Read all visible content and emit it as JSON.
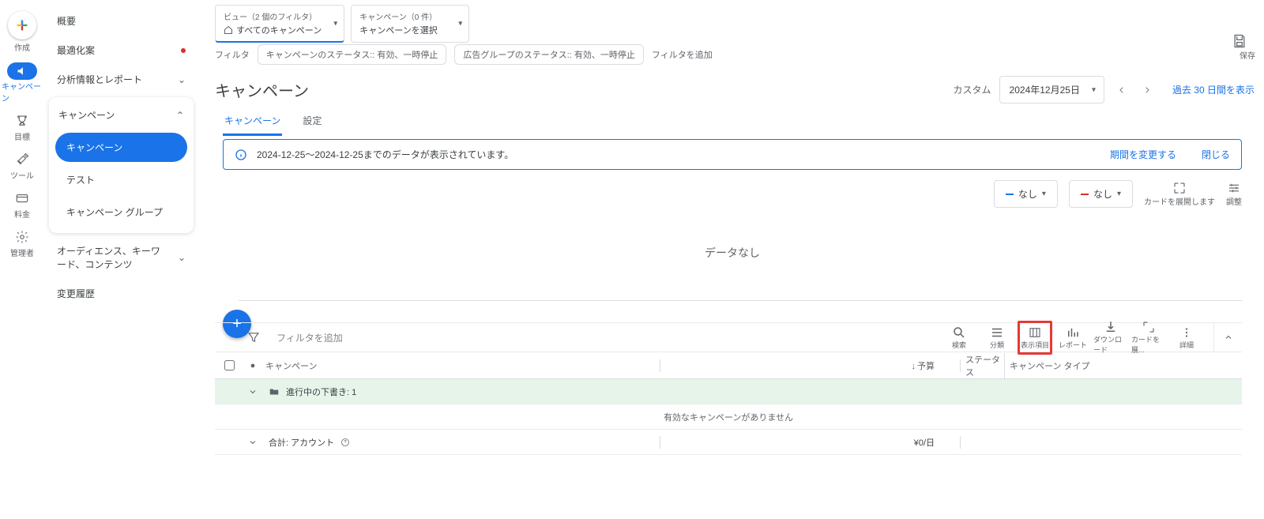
{
  "rail": {
    "create": "作成",
    "campaign": "キャンペーン",
    "goal": "目標",
    "tool": "ツール",
    "fee": "料金",
    "admin": "管理者"
  },
  "side": {
    "overview": "概要",
    "optimization": "最適化案",
    "analysis": "分析情報とレポート",
    "campaign_header": "キャンペーン",
    "campaign": "キャンペーン",
    "test": "テスト",
    "campaign_group": "キャンペーン グループ",
    "audience": "オーディエンス、キーワード、コンテンツ",
    "history": "変更履歴"
  },
  "topsel": {
    "view_title": "ビュー（2 個のフィルタ）",
    "view_body": "すべてのキャンペーン",
    "camp_title": "キャンペーン（0 件）",
    "camp_body": "キャンペーンを選択"
  },
  "save": "保存",
  "filter": {
    "label": "フィルタ",
    "chip1": "キャンペーンのステータス:: 有効、一時停止",
    "chip2": "広告グループのステータス:: 有効、一時停止",
    "add": "フィルタを追加"
  },
  "heading": {
    "title": "キャンペーン",
    "custom": "カスタム",
    "date": "2024年12月25日",
    "compare": "過去 30 日間を表示"
  },
  "tabs": {
    "campaign": "キャンペーン",
    "settings": "設定"
  },
  "banner": {
    "text": "2024-12-25～2024-12-25までのデータが表示されています。",
    "change": "期間を変更する",
    "close": "閉じる"
  },
  "controls": {
    "none": "なし",
    "expand": "カードを展開します",
    "adjust": "調整"
  },
  "empty": "データなし",
  "toolbar": {
    "add_filter": "フィルタを追加",
    "search": "検索",
    "segment": "分類",
    "columns": "表示項目",
    "report": "レポート",
    "download": "ダウンロード",
    "expand_card": "カードを展...",
    "more": "詳細"
  },
  "table": {
    "h_campaign": "キャンペーン",
    "h_budget": "予算",
    "h_status": "ステータス",
    "h_type": "キャンペーン タイプ",
    "draft_row": "進行中の下書き: 1",
    "empty": "有効なキャンペーンがありません",
    "total": "合計: アカウント",
    "total_budget": "¥0/日"
  }
}
